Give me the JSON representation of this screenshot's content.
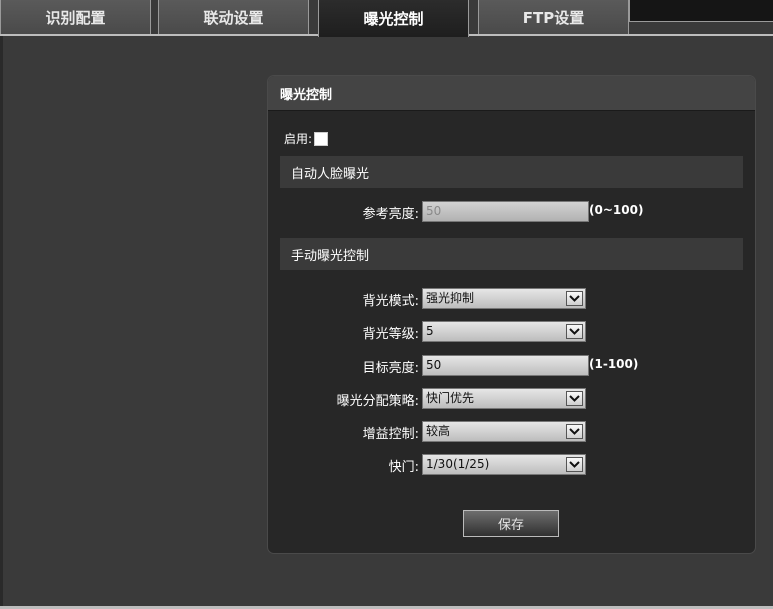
{
  "tabs": [
    {
      "label": "识别配置"
    },
    {
      "label": "联动设置"
    },
    {
      "label": "曝光控制"
    },
    {
      "label": "FTP设置"
    }
  ],
  "panel": {
    "title": "曝光控制",
    "enable_label": "启用:",
    "enable_checked": false,
    "auto_section": "自动人脸曝光",
    "reference_brightness": {
      "label": "参考亮度:",
      "value": "50",
      "range": "(0~100)"
    },
    "manual_section": "手动曝光控制",
    "backlight_mode": {
      "label": "背光模式:",
      "value": "强光抑制"
    },
    "backlight_level": {
      "label": "背光等级:",
      "value": "5"
    },
    "target_brightness": {
      "label": "目标亮度:",
      "value": "50",
      "range": "(1-100)"
    },
    "exposure_strategy": {
      "label": "曝光分配策略:",
      "value": "快门优先"
    },
    "gain_control": {
      "label": "增益控制:",
      "value": "较高"
    },
    "shutter": {
      "label": "快门:",
      "value": "1/30(1/25)"
    },
    "save_label": "保存"
  }
}
